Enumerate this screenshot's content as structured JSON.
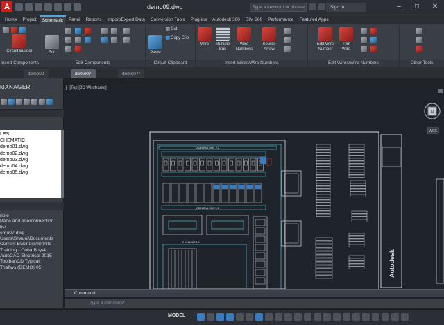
{
  "titlebar": {
    "app_icon": "A",
    "document_title": "demo09.dwg",
    "search_placeholder": "Type a keyword or phrase",
    "signin_label": "Sign In",
    "minimize": "–",
    "maximize": "□",
    "close": "✕"
  },
  "ribbon_tabs": [
    "Home",
    "Project",
    "Schematic",
    "Panel",
    "Reports",
    "Import/Export Data",
    "Conversion Tools",
    "Plug-ins",
    "Autodesk 360",
    "BIM 360",
    "Performance",
    "Featured Apps"
  ],
  "active_ribbon_tab": "Schematic",
  "ribbon": {
    "groups": [
      {
        "label": "Insert Components",
        "buttons": [
          "Circuit Builder"
        ]
      },
      {
        "label": "Edit Components",
        "buttons": [
          "Edit"
        ]
      },
      {
        "label": "Circuit Clipboard",
        "buttons": [
          "Paste",
          "Cut",
          "Copy Clip"
        ]
      },
      {
        "label": "Insert Wires/Wire Numbers",
        "buttons": [
          "Wire",
          "Multiple Bus",
          "Wire Numbers",
          "Source Arrow"
        ]
      },
      {
        "label": "Edit Wires/Wire Numbers",
        "buttons": [
          "Edit Wire Number",
          "Trim Wire"
        ]
      },
      {
        "label": "Other Tools",
        "buttons": []
      }
    ]
  },
  "doc_tabs": [
    "demo00",
    "demo07",
    "demo07*"
  ],
  "active_doc_tab": "demo07",
  "project_manager": {
    "title": "MANAGER",
    "tree": [
      "LES",
      "CHEMATIC",
      "demo01.dwg",
      "demo02.dwg",
      "demo03.dwg",
      "demo04.dwg",
      "demo05.dwg"
    ],
    "details_header": "details",
    "details": [
      "rible",
      "",
      "Pane and Interconnection",
      "list",
      "",
      "emo07.dwg",
      "",
      "Users\\Shauni\\Documents",
      "Current Business\\Infinite",
      "Training - Cuba Boy\\4",
      "AutoCAD Electrical 2015",
      "Toolbar\\CD Typical",
      "Trial\\ws (DEMO) 05"
    ]
  },
  "viewport": {
    "label": "[-][Top][2D Wireframe]",
    "viewcube_face": "N",
    "viewcube_wcs": "WCS"
  },
  "drawing": {
    "panel_brand": "Autodesk",
    "top_label": "2 DIN RAIL UNIT 2-C",
    "mid_label": "2 DIN RAIL UNIT 2-C",
    "bottom_label": "2 DIN UNIT 4-C"
  },
  "command": {
    "label": "Command:",
    "prompt": "Type a command"
  },
  "status": {
    "model_label": "MODEL"
  },
  "colors": {
    "canvas_bg": "#1f242b",
    "drawing_line": "#d8dde2",
    "cyan_line": "#5fd6e6",
    "accent_blue": "#3a7bc0",
    "red_label": "#e04535"
  }
}
